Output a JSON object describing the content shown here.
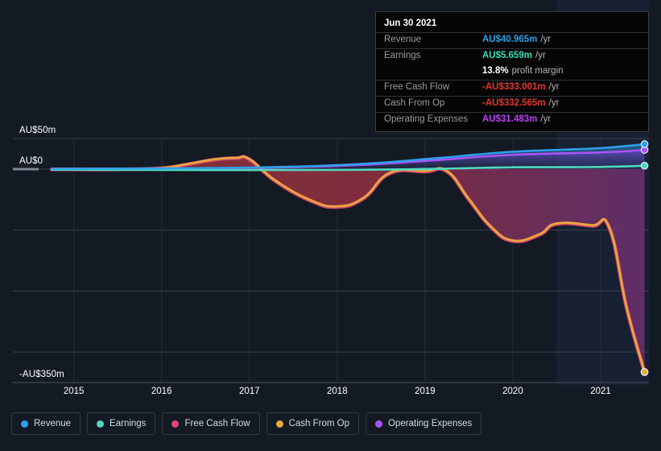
{
  "chart_data": {
    "type": "area",
    "title": "",
    "xlabel": "",
    "ylabel": "",
    "currency": "AU$",
    "ylim": [
      -350,
      50
    ],
    "xlim": [
      2014.6,
      2021.55
    ],
    "grid": true,
    "legend_position": "bottom",
    "y_ticks": [
      {
        "value": 50,
        "label": "AU$50m"
      },
      {
        "value": 0,
        "label": "AU$0"
      },
      {
        "value": -100,
        "label": ""
      },
      {
        "value": -200,
        "label": ""
      },
      {
        "value": -300,
        "label": ""
      },
      {
        "value": -350,
        "label": "-AU$350m"
      }
    ],
    "x_ticks": [
      {
        "value": 2015,
        "label": "2015"
      },
      {
        "value": 2016,
        "label": "2016"
      },
      {
        "value": 2017,
        "label": "2017"
      },
      {
        "value": 2018,
        "label": "2018"
      },
      {
        "value": 2019,
        "label": "2019"
      },
      {
        "value": 2020,
        "label": "2020"
      },
      {
        "value": 2021,
        "label": "2021"
      }
    ],
    "forecast_start": 2020.5,
    "series": [
      {
        "name": "Revenue",
        "color": "#2e9fe8",
        "x": [
          2014.75,
          2015.0,
          2015.5,
          2016.0,
          2016.5,
          2017.0,
          2017.5,
          2018.0,
          2018.5,
          2019.0,
          2019.3,
          2019.6,
          2020.0,
          2020.3,
          2020.6,
          2021.0,
          2021.3,
          2021.5
        ],
        "values": [
          0.5,
          0.6,
          0.9,
          1.2,
          1.8,
          2.6,
          4.0,
          6.5,
          10.5,
          16.5,
          20.0,
          24.0,
          28.5,
          30.5,
          32.0,
          34.5,
          38.0,
          40.965
        ]
      },
      {
        "name": "Earnings",
        "color": "#4fd9c0",
        "x": [
          2014.75,
          2015.0,
          2015.5,
          2016.0,
          2016.5,
          2017.0,
          2017.5,
          2018.0,
          2018.5,
          2019.0,
          2019.3,
          2019.6,
          2020.0,
          2020.3,
          2020.6,
          2021.0,
          2021.3,
          2021.5
        ],
        "values": [
          -1.0,
          -1.0,
          -1.2,
          -1.4,
          -1.5,
          -1.5,
          -1.4,
          -1.2,
          -0.8,
          0.2,
          1.0,
          2.0,
          3.0,
          3.2,
          3.2,
          3.6,
          4.6,
          5.659
        ]
      },
      {
        "name": "Free Cash Flow",
        "color": "#d9486f",
        "x": [
          2014.75,
          2015.0,
          2015.5,
          2016.0,
          2016.3,
          2016.6,
          2016.85,
          2017.0,
          2017.3,
          2017.7,
          2018.0,
          2018.3,
          2018.6,
          2019.0,
          2019.25,
          2019.5,
          2019.75,
          2020.0,
          2020.3,
          2020.5,
          2020.9,
          2021.1,
          2021.3,
          2021.5
        ],
        "values": [
          -0.3,
          -0.3,
          -0.4,
          1.5,
          8.0,
          15.5,
          18.0,
          16.0,
          -20.0,
          -52.0,
          -62.0,
          -48.0,
          -7.0,
          -4.0,
          -4.0,
          -50.0,
          -95.0,
          -118.0,
          -108.0,
          -90.0,
          -93.0,
          -97.0,
          -230.0,
          -333.001
        ]
      },
      {
        "name": "Cash From Op",
        "color": "#e8a93c",
        "x": [
          2014.75,
          2015.0,
          2015.5,
          2016.0,
          2016.3,
          2016.6,
          2016.85,
          2017.0,
          2017.3,
          2017.7,
          2018.0,
          2018.3,
          2018.6,
          2019.0,
          2019.25,
          2019.5,
          2019.75,
          2020.0,
          2020.3,
          2020.5,
          2020.9,
          2021.1,
          2021.3,
          2021.5
        ],
        "values": [
          -0.2,
          -0.2,
          -0.3,
          1.8,
          8.5,
          16.0,
          18.5,
          16.5,
          -19.0,
          -51.0,
          -61.0,
          -47.0,
          -6.0,
          -3.0,
          -3.0,
          -49.0,
          -94.0,
          -117.0,
          -107.0,
          -89.0,
          -92.0,
          -96.0,
          -229.0,
          -332.565
        ]
      },
      {
        "name": "Operating Expenses",
        "color": "#a855f7",
        "x": [
          2014.75,
          2015.0,
          2015.5,
          2016.0,
          2016.5,
          2017.0,
          2017.5,
          2018.0,
          2018.5,
          2019.0,
          2019.3,
          2019.6,
          2020.0,
          2020.3,
          2020.6,
          2021.0,
          2021.3,
          2021.5
        ],
        "values": [
          0.3,
          0.4,
          0.6,
          0.9,
          1.4,
          2.0,
          3.2,
          5.2,
          8.6,
          13.5,
          16.5,
          20.0,
          23.5,
          25.0,
          26.0,
          27.5,
          29.5,
          31.483
        ]
      }
    ]
  },
  "tooltip": {
    "date": "Jun 30 2021",
    "unit": "/yr",
    "rows": [
      {
        "key": "Revenue",
        "value": "AU$40.965m",
        "unit": "/yr",
        "color": "#2e9fe8"
      },
      {
        "key": "Earnings",
        "value": "AU$5.659m",
        "unit": "/yr",
        "color": "#3ddcb6"
      },
      {
        "key": "",
        "value": "13.8%",
        "unit": "profit margin",
        "color": "#ffffff"
      },
      {
        "key": "Free Cash Flow",
        "value": "-AU$333.001m",
        "unit": "/yr",
        "color": "#e8342f"
      },
      {
        "key": "Cash From Op",
        "value": "-AU$332.565m",
        "unit": "/yr",
        "color": "#e8342f"
      },
      {
        "key": "Operating Expenses",
        "value": "AU$31.483m",
        "unit": "/yr",
        "color": "#b842f5"
      }
    ]
  },
  "legend": {
    "items": [
      {
        "label": "Revenue",
        "color": "#2e9fe8"
      },
      {
        "label": "Earnings",
        "color": "#4fd9c0"
      },
      {
        "label": "Free Cash Flow",
        "color": "#d9486f"
      },
      {
        "label": "Cash From Op",
        "color": "#e8a93c"
      },
      {
        "label": "Operating Expenses",
        "color": "#a855f7"
      }
    ]
  }
}
